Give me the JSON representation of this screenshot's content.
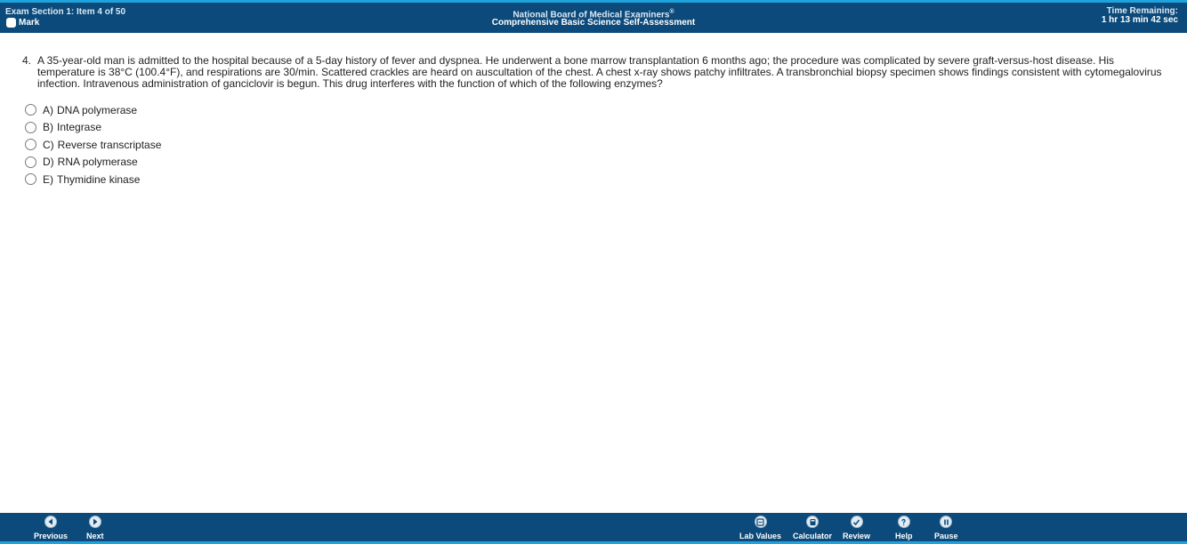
{
  "header": {
    "section_label": "Exam Section 1: Item 4 of 50",
    "mark_label": "Mark",
    "org_name": "National Board of Medical Examiners",
    "org_mark": "®",
    "exam_name": "Comprehensive Basic Science Self-Assessment",
    "time_label": "Time Remaining:",
    "time_value": "1 hr 13 min 42 sec"
  },
  "question": {
    "number": "4.",
    "text": "A 35-year-old man is admitted to the hospital because of a 5-day history of fever and dyspnea. He underwent a bone marrow transplantation 6 months ago; the procedure was complicated by severe graft-versus-host disease. His temperature is 38°C (100.4°F), and respirations are 30/min. Scattered crackles are heard on auscultation of the chest. A chest x-ray shows patchy infiltrates. A transbronchial biopsy specimen shows findings consistent with cytomegalovirus infection. Intravenous administration of ganciclovir is begun. This drug interferes with the function of which of the following enzymes?",
    "options": [
      {
        "letter": "A)",
        "text": "DNA polymerase"
      },
      {
        "letter": "B)",
        "text": "Integrase"
      },
      {
        "letter": "C)",
        "text": "Reverse transcriptase"
      },
      {
        "letter": "D)",
        "text": "RNA polymerase"
      },
      {
        "letter": "E)",
        "text": "Thymidine kinase"
      }
    ]
  },
  "footer": {
    "previous_label": "Previous",
    "next_label": "Next",
    "lab_values_label": "Lab Values",
    "calculator_label": "Calculator",
    "review_label": "Review",
    "help_label": "Help",
    "pause_label": "Pause"
  },
  "icons": {
    "previous": "chevron-left-icon",
    "next": "chevron-right-icon",
    "lab_values": "flask-icon",
    "calculator": "calculator-icon",
    "review": "checkmark-icon",
    "help": "question-icon",
    "pause": "pause-icon"
  },
  "colors": {
    "bar_background": "#0b4a7a",
    "bar_accent": "#1fa3dc",
    "page_background": "#ffffff"
  }
}
